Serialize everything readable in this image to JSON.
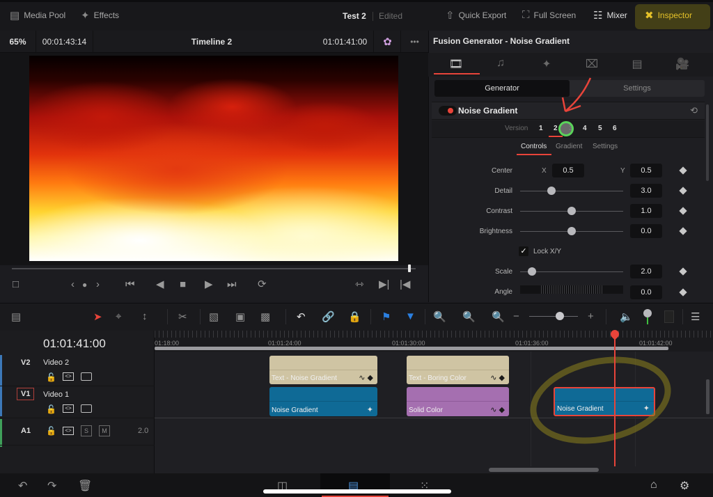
{
  "topbar": {
    "media_pool": "Media Pool",
    "effects": "Effects",
    "project_name": "Test 2",
    "project_status": "Edited",
    "quick_export": "Quick Export",
    "full_screen": "Full Screen",
    "mixer": "Mixer",
    "inspector": "Inspector"
  },
  "viewer": {
    "zoom": "65%",
    "duration": "00:01:43:14",
    "timeline_name": "Timeline 2",
    "timecode": "01:01:41:00",
    "more": "•••"
  },
  "inspector": {
    "title": "Fusion Generator - Noise Gradient",
    "segments": [
      "Generator",
      "Settings"
    ],
    "active_segment": "Generator",
    "effect_name": "Noise Gradient",
    "version_label": "Version",
    "versions": [
      "1",
      "2",
      "3",
      "4",
      "5",
      "6"
    ],
    "active_version": "2",
    "subtabs": [
      "Controls",
      "Gradient",
      "Settings"
    ],
    "active_subtab": "Controls",
    "params": {
      "center_label": "Center",
      "center_x_label": "X",
      "center_x": "0.5",
      "center_y_label": "Y",
      "center_y": "0.5",
      "detail_label": "Detail",
      "detail": "3.0",
      "contrast_label": "Contrast",
      "contrast": "1.0",
      "brightness_label": "Brightness",
      "brightness": "0.0",
      "lock_label": "Lock X/Y",
      "lock_checked": true,
      "scale_label": "Scale",
      "scale": "2.0",
      "angle_label": "Angle",
      "angle": "0.0"
    }
  },
  "timeline": {
    "timecode": "01:01:41:00",
    "ruler": [
      "01:18:00",
      "01:01:24:00",
      "01:01:30:00",
      "01:01:36:00",
      "01:01:42:00"
    ],
    "tracks": [
      {
        "id": "V2",
        "name": "Video 2"
      },
      {
        "id": "V1",
        "name": "Video 1"
      },
      {
        "id": "A1",
        "name": "",
        "level": "2.0",
        "solo": "S",
        "mute": "M"
      }
    ],
    "clips": [
      {
        "track": "V2",
        "label": "Text - Noise Gradient",
        "color": "#cfc4a3"
      },
      {
        "track": "V2",
        "label": "Text - Boring Color",
        "color": "#cfc4a3"
      },
      {
        "track": "V1",
        "label": "Noise Gradient",
        "color": "#0f6a96"
      },
      {
        "track": "V1",
        "label": "Solid Color",
        "color": "#a56fb0"
      },
      {
        "track": "V1",
        "label": "Noise Gradient",
        "color": "#0f6a96",
        "selected": true
      }
    ]
  },
  "colors": {
    "accent_red": "#e8443a",
    "inspector_yellow": "#e6c229",
    "flag_blue": "#2b7fe0"
  }
}
